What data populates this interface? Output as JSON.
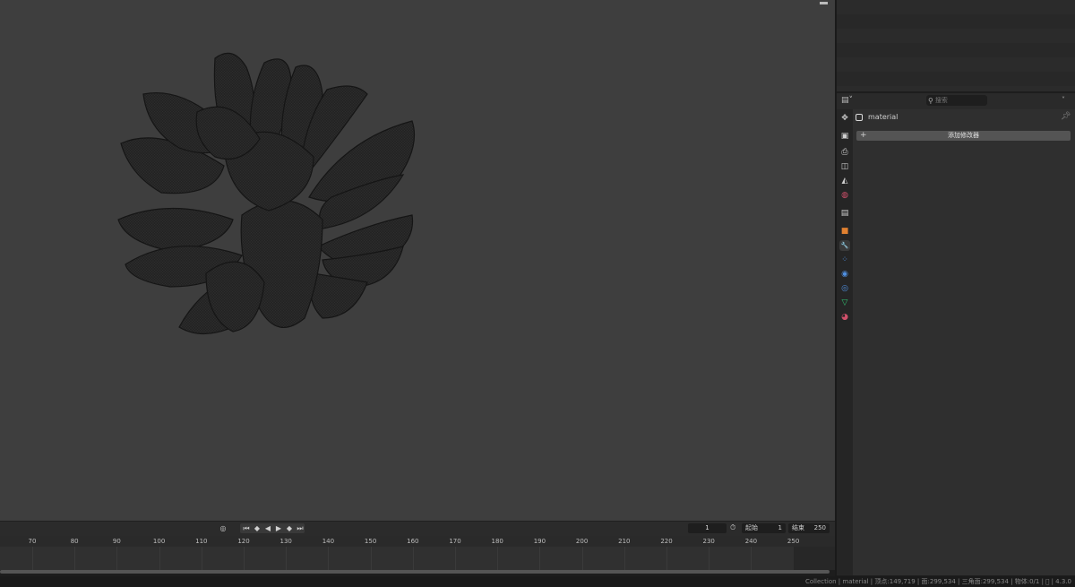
{
  "app": {
    "version": "4.3.0"
  },
  "properties": {
    "search_placeholder": "搜索",
    "object_name": "material",
    "add_modifier_label": "添加修改器",
    "tabs": [
      {
        "name": "tool-icon",
        "glyph": "✥",
        "color": "#cfcfcf"
      },
      {
        "name": "render-icon",
        "glyph": "▣",
        "color": "#cfcfcf"
      },
      {
        "name": "output-icon",
        "glyph": "⎙",
        "color": "#cfcfcf"
      },
      {
        "name": "view-layer-icon",
        "glyph": "◫",
        "color": "#cfcfcf"
      },
      {
        "name": "scene-icon",
        "glyph": "◭",
        "color": "#cfcfcf"
      },
      {
        "name": "world-icon",
        "glyph": "◍",
        "color": "#d0506a"
      },
      {
        "name": "collection-icon",
        "glyph": "▤",
        "color": "#cfcfcf"
      },
      {
        "name": "object-icon",
        "glyph": "■",
        "color": "#e08030"
      },
      {
        "name": "modifier-wrench-icon",
        "glyph": "🔧",
        "color": "#4f8fe0"
      },
      {
        "name": "particles-icon",
        "glyph": "⁘",
        "color": "#4f8fe0"
      },
      {
        "name": "physics-icon",
        "glyph": "◉",
        "color": "#4f8fe0"
      },
      {
        "name": "constraints-icon",
        "glyph": "◎",
        "color": "#4f8fe0"
      },
      {
        "name": "data-icon",
        "glyph": "▽",
        "color": "#30c070"
      },
      {
        "name": "material-icon",
        "glyph": "◕",
        "color": "#d0506a"
      }
    ]
  },
  "timeline": {
    "current_frame": "1",
    "start_label": "起始",
    "start_value": "1",
    "end_label": "结束",
    "end_value": "250",
    "ticks": [
      "70",
      "80",
      "90",
      "100",
      "110",
      "120",
      "130",
      "140",
      "150",
      "160",
      "170",
      "180",
      "190",
      "200",
      "210",
      "220",
      "230",
      "240",
      "250"
    ]
  },
  "status_bar": {
    "text": "Collection | material | 顶点:149,719 | 面:299,534 | 三角面:299,534 | 物体:0/1 | ⃠ | 4.3.0"
  },
  "colors": {
    "viewport_bg": "#3e3e3e",
    "mesh": "#232323",
    "accent_blue": "#4f8fe0"
  }
}
